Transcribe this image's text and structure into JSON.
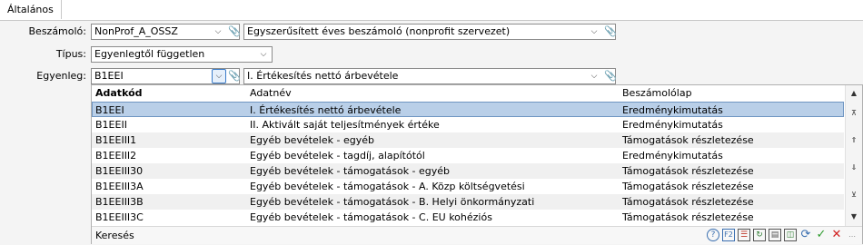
{
  "tab": {
    "label": "Általános"
  },
  "form": {
    "beszamolo_label": "Beszámoló:",
    "beszamolo_code": "NonProf_A_OSSZ",
    "beszamolo_name": "Egyszerűsített éves beszámoló (nonprofit szervezet)",
    "tipus_label": "Típus:",
    "tipus_value": "Egyenlegtől független",
    "egyenleg_label": "Egyenleg:",
    "egyenleg_code": "B1EEI",
    "egyenleg_name": "I. Értékesítés nettó árbevétele"
  },
  "grid": {
    "columns": [
      "Adatkód",
      "Adatnév",
      "Beszámolólap"
    ],
    "rows": [
      {
        "code": "B1EEI",
        "name": "I. Értékesítés nettó árbevétele",
        "sheet": "Eredménykimutatás"
      },
      {
        "code": "B1EEII",
        "name": "II. Aktivált saját teljesítmények értéke",
        "sheet": "Eredménykimutatás"
      },
      {
        "code": "B1EEIII1",
        "name": "Egyéb bevételek - egyéb",
        "sheet": "Támogatások részletezése"
      },
      {
        "code": "B1EEIII2",
        "name": "Egyéb bevételek - tagdíj, alapítótól",
        "sheet": "Eredménykimutatás"
      },
      {
        "code": "B1EEIII30",
        "name": "Egyéb bevételek - támogatások - egyéb",
        "sheet": "Támogatások részletezése"
      },
      {
        "code": "B1EEIII3A",
        "name": "Egyéb bevételek - támogatások - A. Közp költségvetési",
        "sheet": "Támogatások részletezése"
      },
      {
        "code": "B1EEIII3B",
        "name": "Egyéb bevételek - támogatások - B. Helyi önkormányzati",
        "sheet": "Támogatások részletezése"
      },
      {
        "code": "B1EEIII3C",
        "name": "Egyéb bevételek - támogatások - C. EU kohéziós",
        "sheet": "Támogatások részletezése"
      }
    ],
    "selected_index": 0,
    "search_label": "Keresés"
  },
  "icons": {
    "dropdown": "chevron-down-icon",
    "clip": "paperclip-icon",
    "footer": [
      "help-icon",
      "f2-icon",
      "filter-icon",
      "refresh-list-icon",
      "export-icon",
      "columns-icon",
      "reload-icon",
      "ok-icon",
      "cancel-icon",
      "resize-grip-icon"
    ]
  },
  "colors": {
    "selection": "#b9cfe8",
    "ok": "#2e9b2e",
    "cancel": "#d11f1f",
    "focus": "#3b7cc9"
  }
}
